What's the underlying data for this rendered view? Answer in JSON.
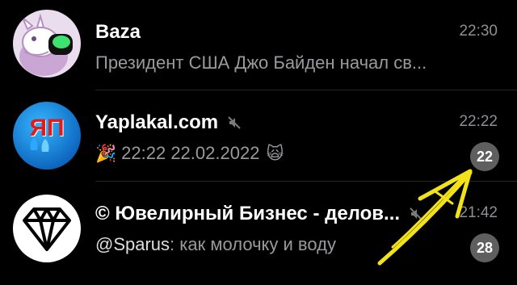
{
  "chats": [
    {
      "title": "Baza",
      "time": "22:30",
      "preview_text": "Президент США Джо Байден начал св...",
      "muted": false,
      "avatar_icon": "cartoon-goat-avatar-icon"
    },
    {
      "title": "Yaplakal.com",
      "time": "22:22",
      "preview_emoji_left": "🎉",
      "preview_text": "22:22 22.02.2022",
      "preview_emoji_right": "🙀",
      "unread": "22",
      "muted": true,
      "avatar_label": "ЯП",
      "avatar_icon": "yaplakal-logo-icon"
    },
    {
      "title": "© Ювелирный Бизнес - делов...",
      "time": "21:42",
      "preview_sender": "@Sparus",
      "preview_text": ": как молочку и воду",
      "unread": "28",
      "muted": true,
      "avatar_icon": "diamond-icon"
    }
  ],
  "colors": {
    "background": "#000000",
    "title": "#ffffff",
    "meta": "#8e8e93",
    "badge": "#5f5f5f",
    "annotation_arrow": "#f2e21a"
  }
}
